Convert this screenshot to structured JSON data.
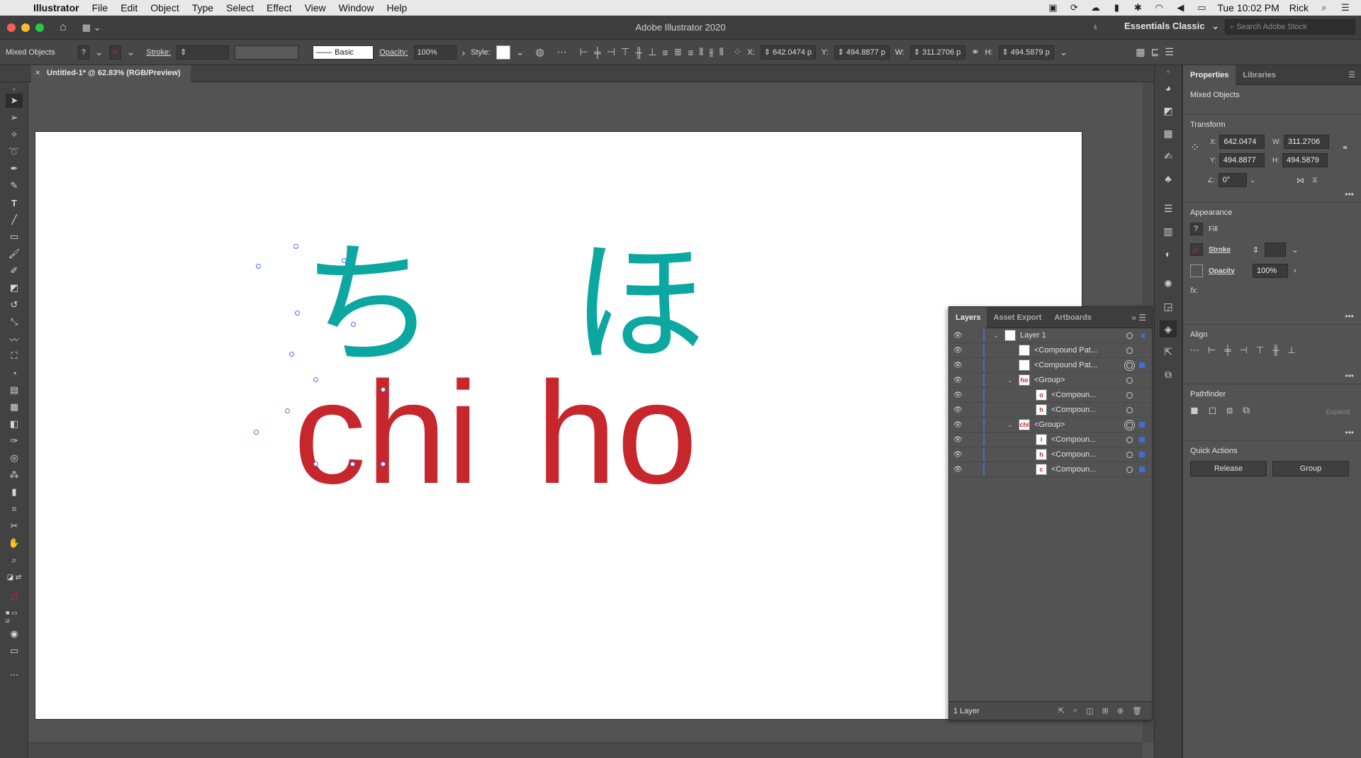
{
  "menubar": {
    "app": "Illustrator",
    "items": [
      "File",
      "Edit",
      "Object",
      "Type",
      "Select",
      "Effect",
      "View",
      "Window",
      "Help"
    ],
    "clock": "Tue 10:02 PM",
    "user": "Rick"
  },
  "titlebar": {
    "title": "Adobe Illustrator 2020",
    "workspace": "Essentials Classic",
    "search_placeholder": "Search Adobe Stock"
  },
  "controlbar": {
    "selection_type": "Mixed Objects",
    "stroke_label": "Stroke:",
    "brush_label": "Basic",
    "opacity_label": "Opacity:",
    "opacity_value": "100%",
    "style_label": "Style:",
    "x_label": "X:",
    "x_value": "642.0474 p",
    "y_label": "Y:",
    "y_value": "494.8877 p",
    "w_label": "W:",
    "w_value": "311.2706 p",
    "h_label": "H:",
    "h_value": "494.5879 p"
  },
  "document": {
    "tab_label": "Untitled-1* @ 62.83% (RGB/Preview)"
  },
  "artboard": {
    "kana_chi": "ち",
    "kana_ho": "ほ",
    "latin_chi": "chi",
    "latin_ho": "ho",
    "kana_color": "#0ba7a0",
    "latin_color": "#c7262d"
  },
  "layers_panel": {
    "tabs": [
      "Layers",
      "Asset Export",
      "Artboards"
    ],
    "rows": [
      {
        "name": "Layer 1",
        "thumb": "",
        "indent": 0
      },
      {
        "name": "<Compound Pat...",
        "thumb": "",
        "indent": 1
      },
      {
        "name": "<Compound Pat...",
        "thumb": "",
        "indent": 1
      },
      {
        "name": "<Group>",
        "thumb": "ho",
        "indent": 1
      },
      {
        "name": "<Compoun...",
        "thumb": "o",
        "indent": 2
      },
      {
        "name": "<Compoun...",
        "thumb": "h",
        "indent": 2
      },
      {
        "name": "<Group>",
        "thumb": "chi",
        "indent": 1
      },
      {
        "name": "<Compoun...",
        "thumb": "i",
        "indent": 2
      },
      {
        "name": "<Compoun...",
        "thumb": "h",
        "indent": 2
      },
      {
        "name": "<Compoun...",
        "thumb": "c",
        "indent": 2
      }
    ],
    "footer": "1 Layer"
  },
  "properties": {
    "tabs": [
      "Properties",
      "Libraries"
    ],
    "selection": "Mixed Objects",
    "transform_title": "Transform",
    "x_label": "X:",
    "x": "642.0474",
    "y_label": "Y:",
    "y": "494.8877",
    "w_label": "W:",
    "w": "311.2706",
    "h_label": "H:",
    "h": "494.5879",
    "angle": "0°",
    "appearance_title": "Appearance",
    "fill_label": "Fill",
    "stroke_label": "Stroke",
    "opacity_label": "Opacity",
    "opacity_value": "100%",
    "fx_label": "fx.",
    "align_title": "Align",
    "pathfinder_title": "Pathfinder",
    "expand_label": "Expand",
    "quick_actions_title": "Quick Actions",
    "release_label": "Release",
    "group_label": "Group"
  }
}
